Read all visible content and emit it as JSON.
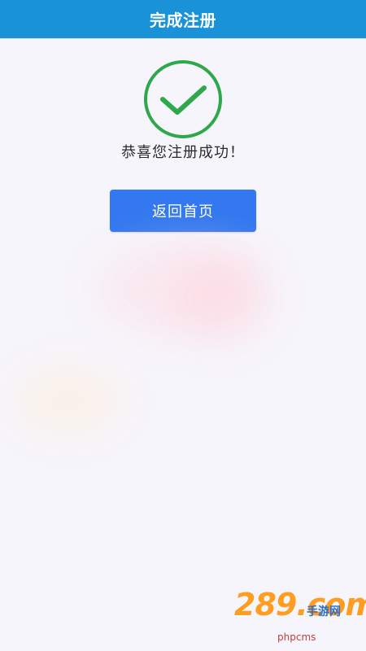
{
  "header": {
    "title": "完成注册"
  },
  "status": {
    "message": "恭喜您注册成功！",
    "icon": "check-circle-icon",
    "icon_color": "#2ea84a"
  },
  "actions": {
    "home_button_label": "返回首页",
    "primary_color": "#3378f0"
  },
  "watermark": {
    "brand": "289.com",
    "sub": "手游网",
    "domain": "phpcms"
  }
}
